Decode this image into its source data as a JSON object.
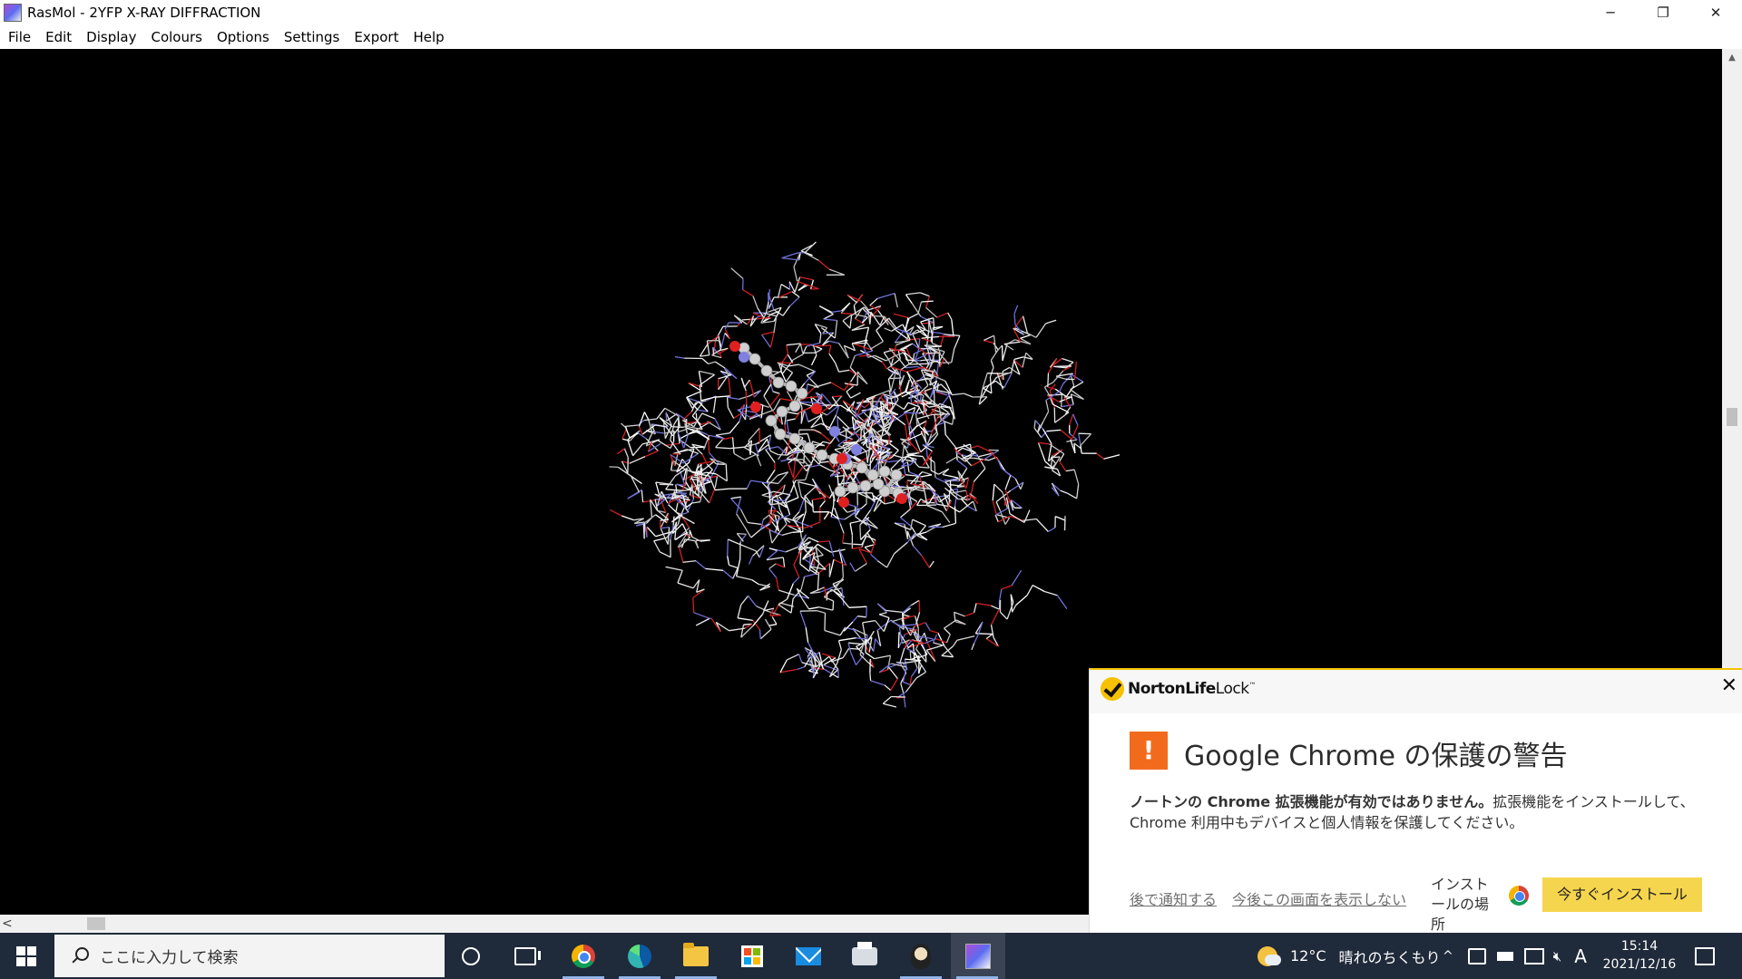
{
  "window": {
    "title": "RasMol - 2YFP X-RAY DIFFRACTION",
    "controls": {
      "minimize": "─",
      "restore": "❐",
      "close": "✕"
    }
  },
  "menu": [
    "File",
    "Edit",
    "Display",
    "Colours",
    "Options",
    "Settings",
    "Export",
    "Help"
  ],
  "scrollbar": {
    "left_arrow": "<",
    "up_arrow": "▲",
    "down_arrow": "▼"
  },
  "norton": {
    "brand_bold": "NortonLife",
    "brand_light": "Lock",
    "brand_tm": "™",
    "close": "✕",
    "warn_symbol": "!",
    "title": "Google Chrome の保護の警告",
    "body_bold": "ノートンの Chrome 拡張機能が有効ではありません。",
    "body_normal": "拡張機能をインストールして、Chrome 利用中もデバイスと個人情報を保護してください。",
    "link_later": "後で通知する",
    "link_never": "今後この画面を表示しない",
    "install_location": "インストールの場所",
    "install_button": "今すぐインストール",
    "accent": "#f5c400",
    "warn_color": "#f26b1d"
  },
  "taskbar": {
    "search_placeholder": "ここに入力して検索",
    "apps": [
      "cortana-icon",
      "task-view-icon",
      "chrome-icon",
      "edge-icon",
      "file-explorer-icon",
      "store-icon",
      "mail-icon",
      "printer-icon",
      "penguin-app-icon",
      "rasmol-icon"
    ],
    "weather_temp": "12°C",
    "weather_text": "晴れのちくもり",
    "tray_caret": "^",
    "ime": "A",
    "time": "15:14",
    "date": "2021/12/16"
  }
}
